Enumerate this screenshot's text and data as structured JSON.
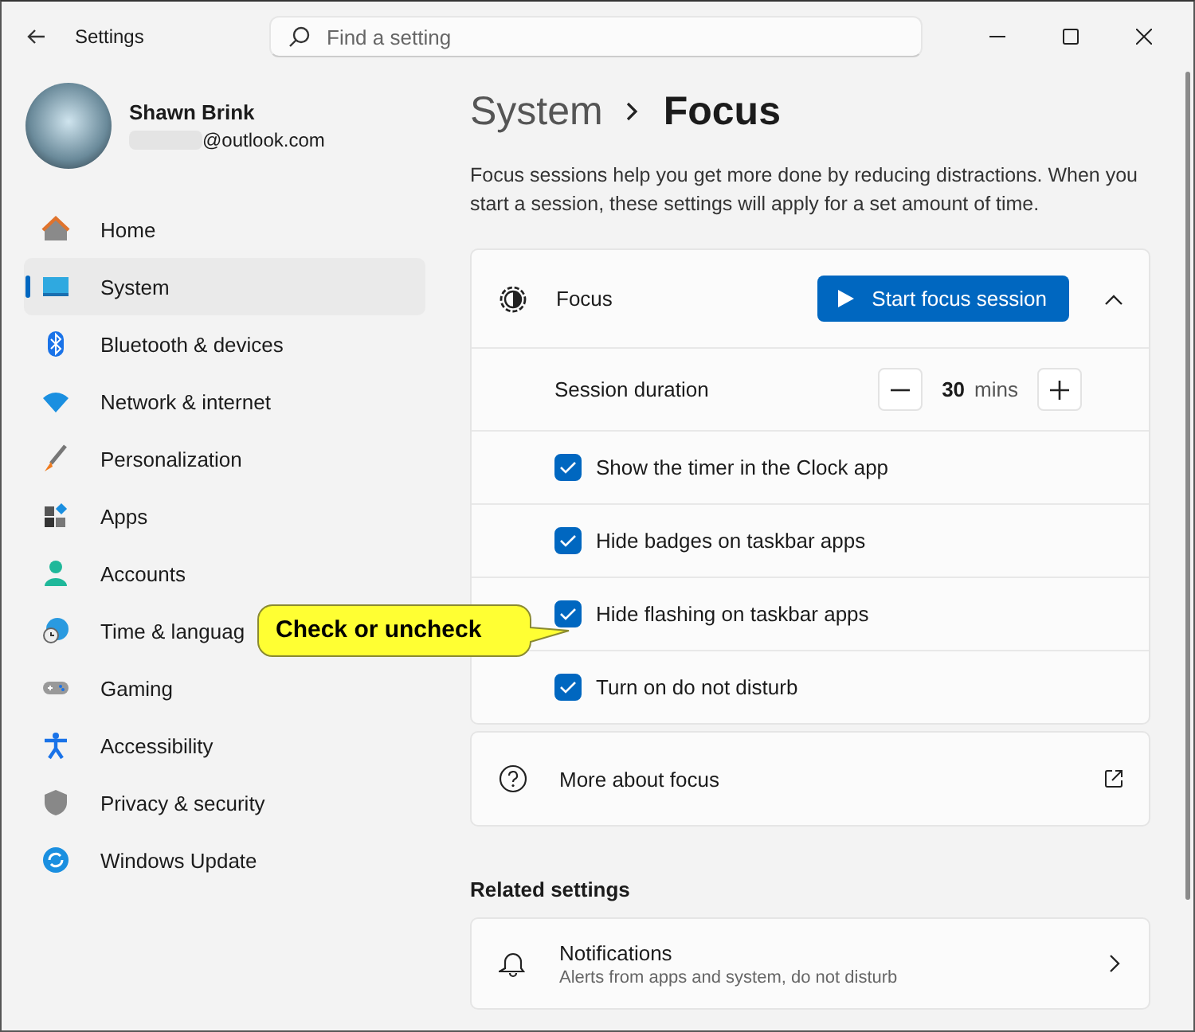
{
  "window": {
    "title": "Settings"
  },
  "search": {
    "placeholder": "Find a setting"
  },
  "account": {
    "name": "Shawn Brink",
    "email": "@outlook.com"
  },
  "sidebar": {
    "items": [
      {
        "label": "Home",
        "selected": false
      },
      {
        "label": "System",
        "selected": true
      },
      {
        "label": "Bluetooth & devices",
        "selected": false
      },
      {
        "label": "Network & internet",
        "selected": false
      },
      {
        "label": "Personalization",
        "selected": false
      },
      {
        "label": "Apps",
        "selected": false
      },
      {
        "label": "Accounts",
        "selected": false
      },
      {
        "label": "Time & languag",
        "selected": false
      },
      {
        "label": "Gaming",
        "selected": false
      },
      {
        "label": "Accessibility",
        "selected": false
      },
      {
        "label": "Privacy & security",
        "selected": false
      },
      {
        "label": "Windows Update",
        "selected": false
      }
    ]
  },
  "breadcrumb": {
    "parent": "System",
    "current": "Focus"
  },
  "description": "Focus sessions help you get more done by reducing distractions. When you start a session, these settings will apply for a set amount of time.",
  "focus": {
    "title": "Focus",
    "start_button": "Start focus session",
    "expanded": true,
    "duration": {
      "label": "Session duration",
      "value": "30",
      "unit": "mins"
    },
    "options": [
      {
        "label": "Show the timer in the Clock app",
        "checked": true
      },
      {
        "label": "Hide badges on taskbar apps",
        "checked": true
      },
      {
        "label": "Hide flashing on taskbar apps",
        "checked": true
      },
      {
        "label": "Turn on do not disturb",
        "checked": true
      }
    ]
  },
  "more": {
    "label": "More about focus"
  },
  "related": {
    "heading": "Related settings",
    "items": [
      {
        "title": "Notifications",
        "subtitle": "Alerts from apps and system, do not disturb"
      }
    ]
  },
  "callout": {
    "text": "Check or uncheck"
  }
}
